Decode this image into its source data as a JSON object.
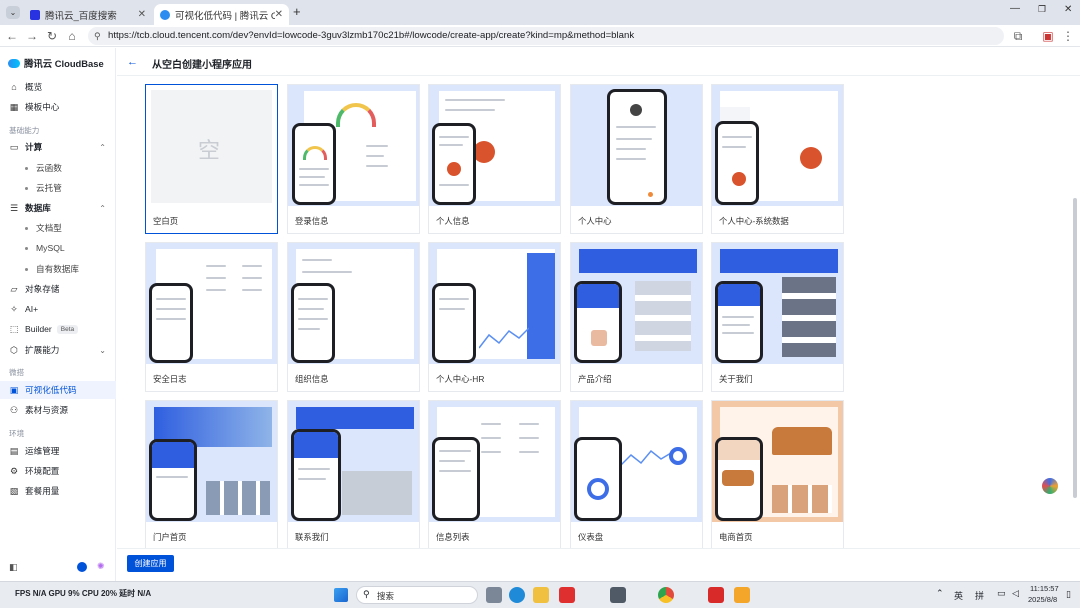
{
  "browser": {
    "tabs": [
      {
        "title": "腾讯云_百度搜索",
        "active": false
      },
      {
        "title": "可视化低代码 | 腾讯云 Cloud",
        "active": true
      }
    ],
    "new_tab": "+",
    "url": "https://tcb.cloud.tencent.com/dev?envId=lowcode-3guv3lzmb170c21b#/lowcode/create-app/create?kind=mp&method=blank"
  },
  "sidebar": {
    "logo": "腾讯云 CloudBase",
    "groups": {
      "basic": "基础能力",
      "micro": "微搭",
      "env": "环境"
    },
    "items": {
      "overview": "概览",
      "templates": "模板中心",
      "compute": "计算",
      "cloud_function": "云函数",
      "cloud_hosting": "云托管",
      "database": "数据库",
      "document_db": "文档型",
      "mysql": "MySQL",
      "own_db": "自有数据库",
      "storage": "对象存储",
      "ai": "AI+",
      "builder": "Builder",
      "builder_badge": "Beta",
      "extension": "扩展能力",
      "lowcode": "可视化低代码",
      "assets": "素材与资源",
      "ops": "运维管理",
      "env_config": "环境配置",
      "plan_usage": "套餐用量"
    }
  },
  "main": {
    "back": "←",
    "title": "从空白创建小程序应用",
    "cards": [
      {
        "label": "空白页",
        "placeholder": "空",
        "selected": true
      },
      {
        "label": "登录信息"
      },
      {
        "label": "个人信息"
      },
      {
        "label": "个人中心"
      },
      {
        "label": "个人中心-系统数据"
      },
      {
        "label": "安全日志"
      },
      {
        "label": "组织信息"
      },
      {
        "label": "个人中心-HR"
      },
      {
        "label": "产品介绍"
      },
      {
        "label": "关于我们"
      },
      {
        "label": "门户首页"
      },
      {
        "label": "联系我们"
      },
      {
        "label": "信息列表"
      },
      {
        "label": "仪表盘"
      },
      {
        "label": "电商首页"
      }
    ],
    "create_button": "创建应用"
  },
  "taskbar": {
    "perf": "FPS N/A GPU 9% CPU 20% 延时 N/A",
    "search": "搜索",
    "ime1": "英",
    "ime2": "拼",
    "time": "11:15:57",
    "date": "2025/8/8"
  }
}
